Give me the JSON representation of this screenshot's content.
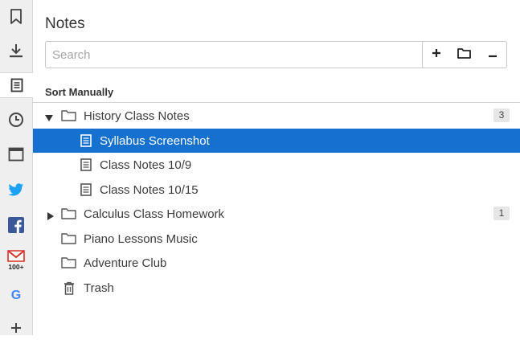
{
  "rail": {
    "items": [
      {
        "icon": "bookmark-icon"
      },
      {
        "icon": "download-icon"
      },
      {
        "icon": "notes-icon",
        "active": true
      },
      {
        "icon": "history-clock-icon"
      },
      {
        "icon": "window-icon"
      },
      {
        "icon": "twitter-icon",
        "color": "#1da1f2"
      },
      {
        "icon": "facebook-icon",
        "color": "#3b5998"
      },
      {
        "icon": "gmail-icon",
        "color": "#d93025",
        "badge": "100+"
      },
      {
        "icon": "google-icon",
        "color": "#4285f4",
        "text": "G"
      },
      {
        "icon": "add-panel-icon",
        "text": "+"
      }
    ]
  },
  "panel": {
    "title": "Notes",
    "search_placeholder": "Search",
    "toolbar": {
      "add": "+",
      "minus": "−"
    },
    "sort_label": "Sort Manually"
  },
  "tree": [
    {
      "label": "History Class Notes",
      "type": "folder",
      "expanded": true,
      "count": "3"
    },
    {
      "label": "Syllabus Screenshot",
      "type": "note",
      "selected": true
    },
    {
      "label": "Class Notes 10/9",
      "type": "note"
    },
    {
      "label": "Class Notes 10/15",
      "type": "note"
    },
    {
      "label": "Calculus Class Homework",
      "type": "folder",
      "expanded": false,
      "count": "1"
    },
    {
      "label": "Piano Lessons Music",
      "type": "folder"
    },
    {
      "label": "Adventure Club",
      "type": "folder"
    },
    {
      "label": "Trash",
      "type": "trash"
    }
  ],
  "colors": {
    "selection": "#1570cf",
    "rail_bg": "#efefef"
  }
}
